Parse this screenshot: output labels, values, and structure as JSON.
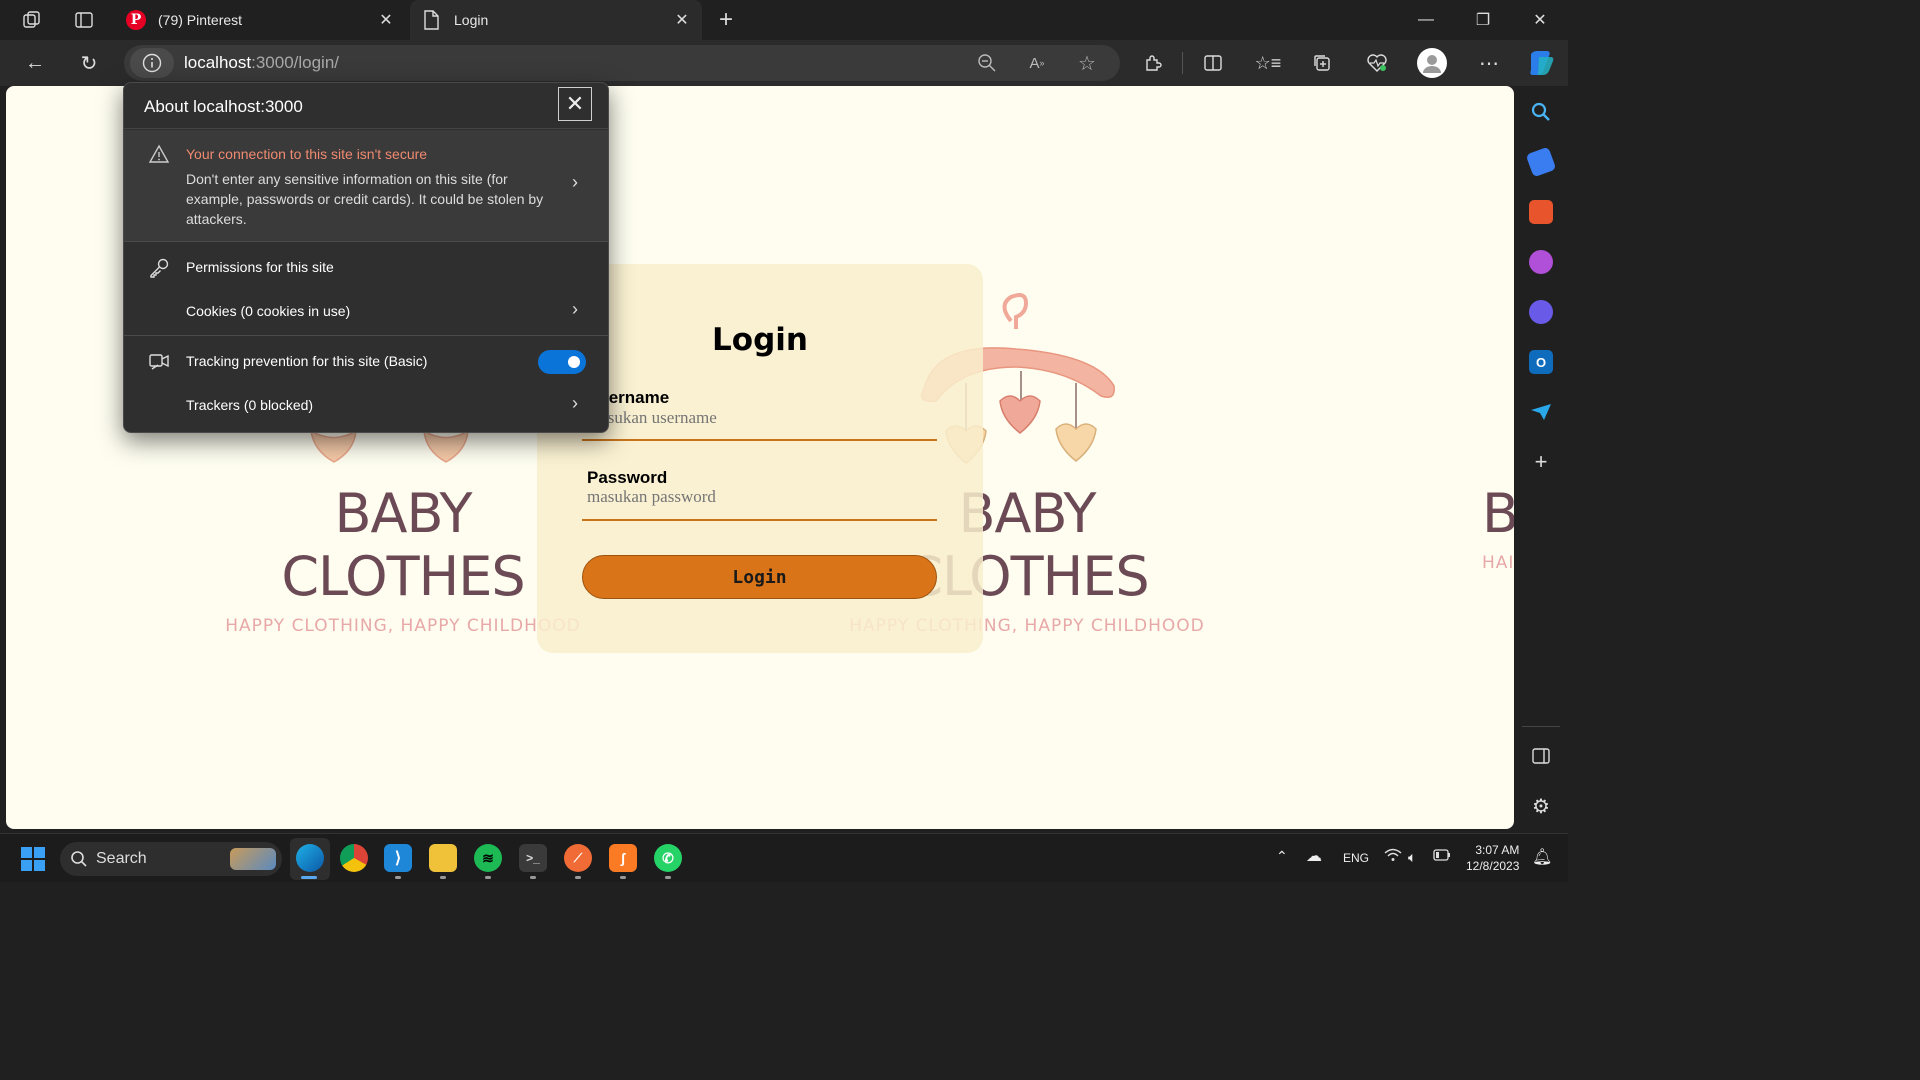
{
  "browser": {
    "tabs": [
      {
        "label": "(79) Pinterest",
        "icon": "pinterest-icon"
      },
      {
        "label": "Login",
        "icon": "page-icon"
      }
    ],
    "url_host": "localhost",
    "url_path": ":3000/login/"
  },
  "popup": {
    "title": "About localhost:3000",
    "warning_title": "Your connection to this site isn't secure",
    "warning_body": "Don't enter any sensitive information on this site (for example, passwords or credit cards). It could be stolen by attackers.",
    "permissions_label": "Permissions for this site",
    "cookies_label": "Cookies (0 cookies in use)",
    "tracking_label": "Tracking prevention for this site (Basic)",
    "tracking_enabled": true,
    "trackers_label": "Trackers (0 blocked)"
  },
  "page": {
    "brand_name": "BABY CLOTHES",
    "brand_tagline": "HAPPY CLOTHING, HAPPY CHILDHOOD",
    "brand_name_partial": "B",
    "brand_tagline_partial": "HAI",
    "login_title": "Login",
    "username_label": "Username",
    "username_placeholder": "masukan username",
    "password_label": "Password",
    "password_placeholder": "masukan password",
    "login_button": "Login",
    "accent_color": "#d97418"
  },
  "taskbar": {
    "search_label": "Search",
    "language": "ENG",
    "time": "3:07 AM",
    "date": "12/8/2023"
  }
}
